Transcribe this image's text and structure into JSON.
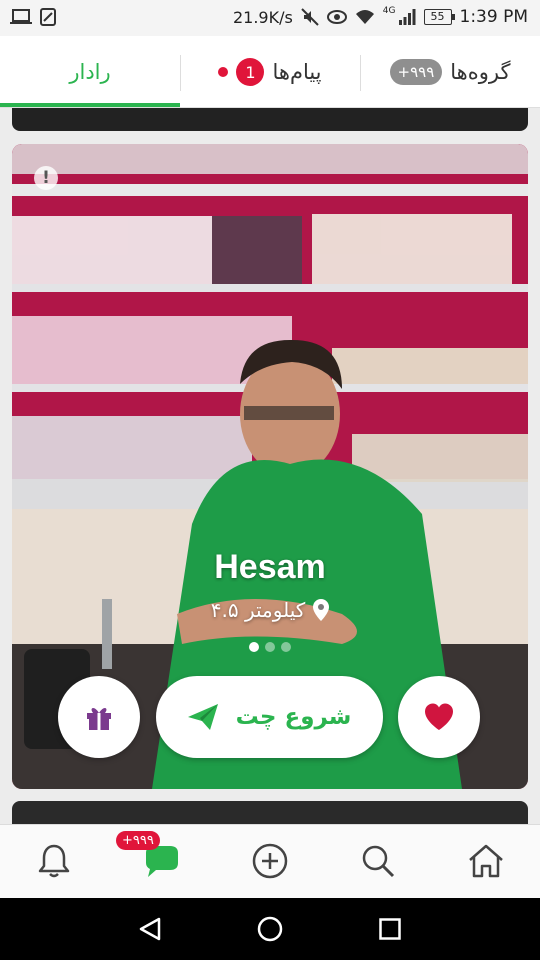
{
  "status_bar": {
    "network_speed": "21.9K/s",
    "network_type": "4G",
    "battery": "55",
    "time": "1:39 PM",
    "icons": [
      "laptop-icon",
      "sim-icon",
      "mute-icon",
      "eye-icon",
      "wifi-icon",
      "signal-icon"
    ]
  },
  "tabs": {
    "radar": "رادار",
    "messages": "پیام‌ها",
    "messages_badge": "1",
    "groups": "گروه‌ها",
    "groups_badge": "+۹۹۹",
    "active": "radar"
  },
  "card": {
    "name": "Hesam",
    "distance": "۴.۵ کیلومتر",
    "photo_count": 3,
    "active_photo": 1,
    "chat_button": "شروع چت"
  },
  "bottom_nav": {
    "items": [
      "bell-icon",
      "chat-icon",
      "add-icon",
      "search-icon",
      "home-icon"
    ],
    "chat_badge": "+۹۹۹"
  },
  "colors": {
    "accent": "#2bb44f",
    "badge": "#e0153a",
    "heart": "#d0153f",
    "gift": "#7b3a8e"
  }
}
